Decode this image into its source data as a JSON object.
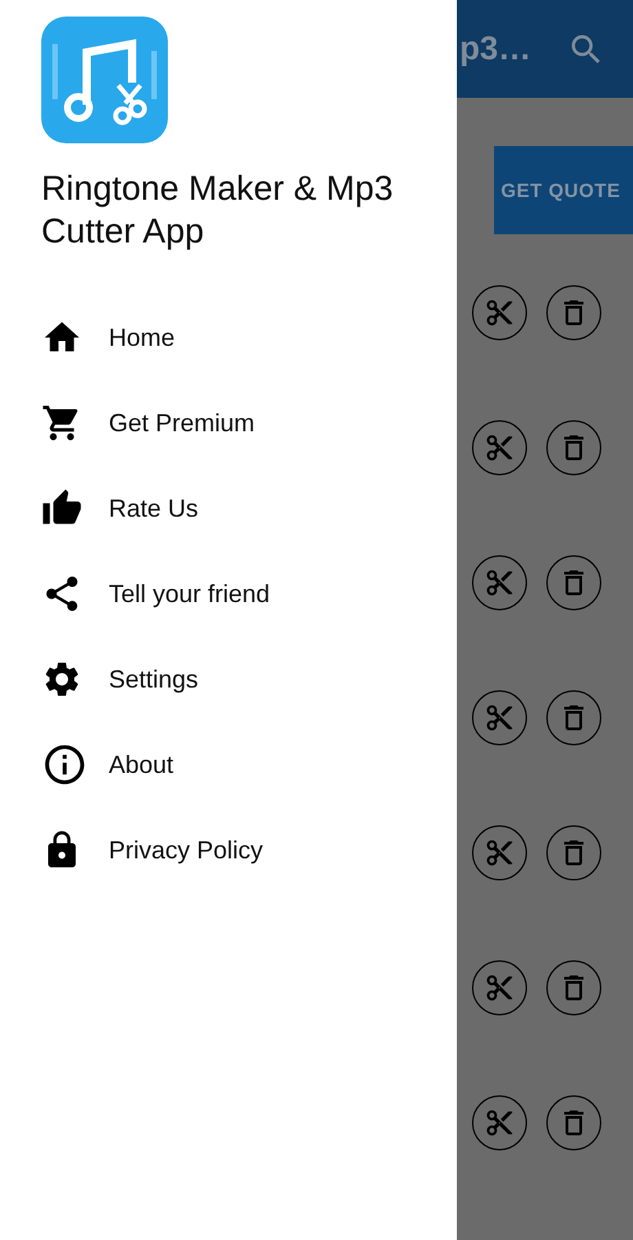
{
  "background_screen": {
    "app_bar": {
      "title": "p3…"
    },
    "quote_button": {
      "label": "GET QUOTE"
    },
    "rows": [
      {
        "kind": "actions"
      },
      {
        "kind": "actions"
      },
      {
        "kind": "actions"
      },
      {
        "kind": "actions"
      },
      {
        "kind": "actions"
      },
      {
        "kind": "actions"
      },
      {
        "kind": "actions"
      }
    ]
  },
  "drawer": {
    "app_name": "Ringtone Maker & Mp3 Cutter App",
    "items": [
      {
        "kind": "home",
        "label": "Home"
      },
      {
        "kind": "cart",
        "label": "Get Premium"
      },
      {
        "kind": "thumb",
        "label": "Rate Us"
      },
      {
        "kind": "share",
        "label": "Tell your friend"
      },
      {
        "kind": "settings",
        "label": "Settings"
      },
      {
        "kind": "info",
        "label": "About"
      },
      {
        "kind": "lock",
        "label": "Privacy Policy"
      }
    ]
  }
}
